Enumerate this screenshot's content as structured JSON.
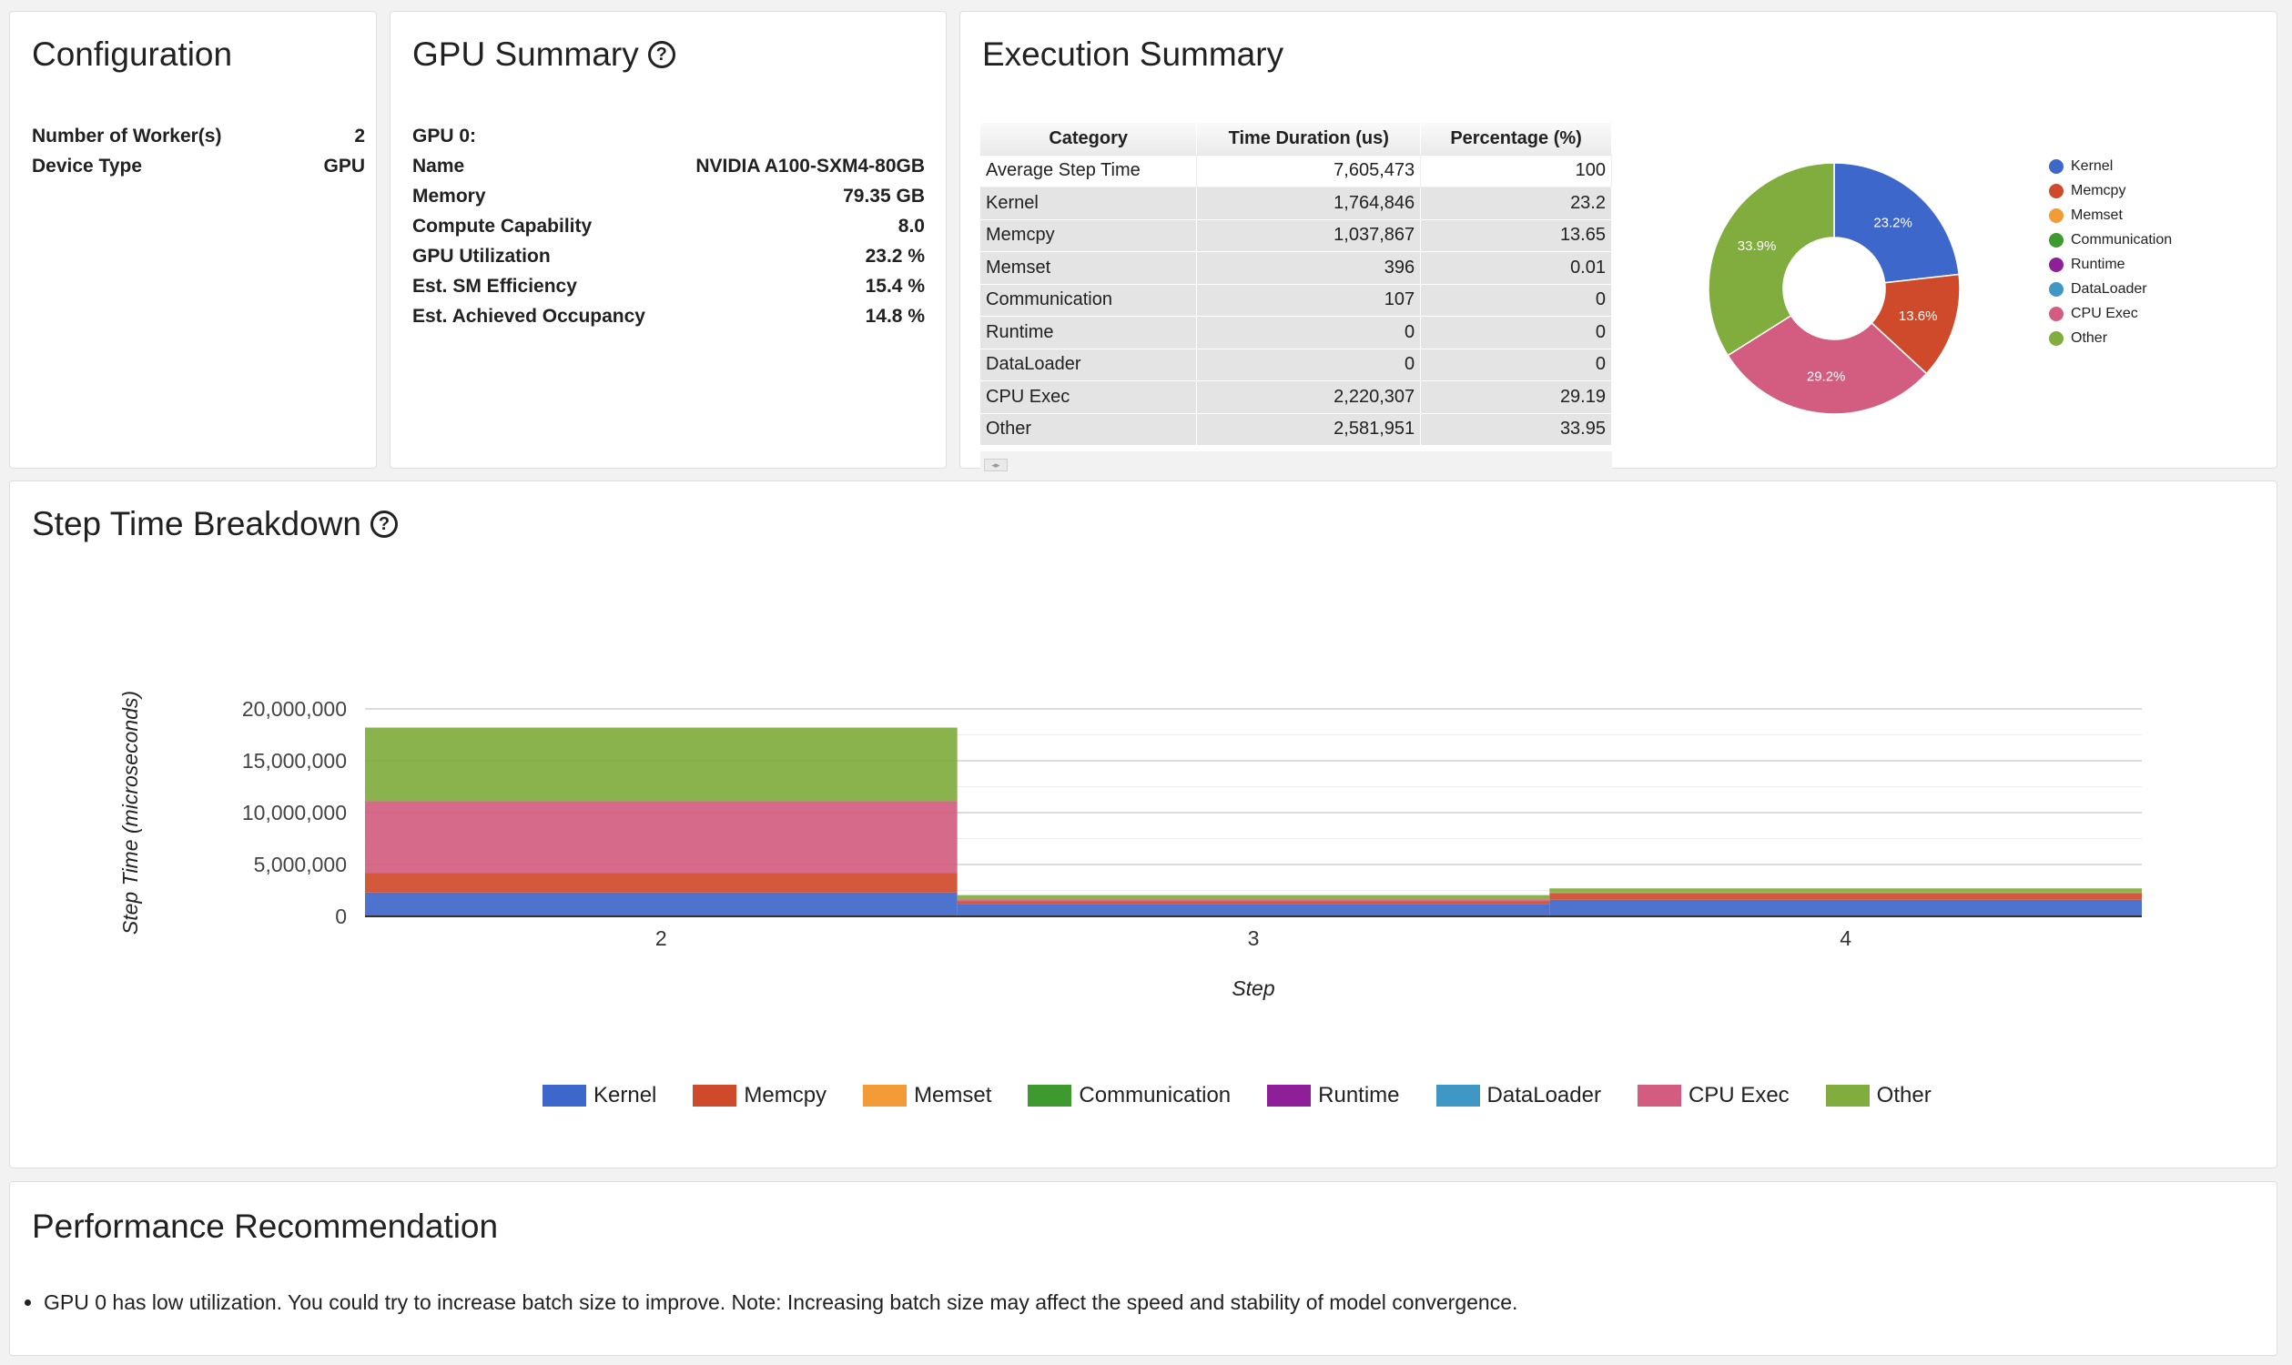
{
  "configuration": {
    "title": "Configuration",
    "rows": [
      {
        "label": "Number of Worker(s)",
        "value": "2"
      },
      {
        "label": "Device Type",
        "value": "GPU"
      }
    ]
  },
  "gpu_summary": {
    "title": "GPU Summary",
    "help_icon": "help-circle-icon",
    "gpu_label": "GPU 0:",
    "rows": [
      {
        "label": "Name",
        "value": "NVIDIA A100-SXM4-80GB"
      },
      {
        "label": "Memory",
        "value": "79.35 GB"
      },
      {
        "label": "Compute Capability",
        "value": "8.0"
      },
      {
        "label": "GPU Utilization",
        "value": "23.2 %"
      },
      {
        "label": "Est. SM Efficiency",
        "value": "15.4 %"
      },
      {
        "label": "Est. Achieved Occupancy",
        "value": "14.8 %"
      }
    ]
  },
  "execution_summary": {
    "title": "Execution Summary",
    "columns": [
      "Category",
      "Time Duration (us)",
      "Percentage (%)"
    ],
    "rows": [
      {
        "category": "Average Step Time",
        "duration": "7,605,473",
        "percentage": "100"
      },
      {
        "category": "Kernel",
        "duration": "1,764,846",
        "percentage": "23.2"
      },
      {
        "category": "Memcpy",
        "duration": "1,037,867",
        "percentage": "13.65"
      },
      {
        "category": "Memset",
        "duration": "396",
        "percentage": "0.01"
      },
      {
        "category": "Communication",
        "duration": "107",
        "percentage": "0"
      },
      {
        "category": "Runtime",
        "duration": "0",
        "percentage": "0"
      },
      {
        "category": "DataLoader",
        "duration": "0",
        "percentage": "0"
      },
      {
        "category": "CPU Exec",
        "duration": "2,220,307",
        "percentage": "29.19"
      },
      {
        "category": "Other",
        "duration": "2,581,951",
        "percentage": "33.95"
      }
    ],
    "pie_legend": [
      "Kernel",
      "Memcpy",
      "Memset",
      "Communication",
      "Runtime",
      "DataLoader",
      "CPU Exec",
      "Other"
    ]
  },
  "colors": {
    "Kernel": "#3e67cb",
    "Memcpy": "#cf4a2b",
    "Memset": "#f39c37",
    "Communication": "#3e9a2f",
    "Runtime": "#8e1f98",
    "DataLoader": "#3f97c5",
    "CPU Exec": "#d35d80",
    "Other": "#81ad3e"
  },
  "step_breakdown": {
    "title": "Step Time Breakdown",
    "help_icon": "help-circle-icon"
  },
  "performance": {
    "title": "Performance Recommendation",
    "items": [
      "GPU 0 has low utilization. You could try to increase batch size to improve. Note: Increasing batch size may affect the speed and stability of model convergence."
    ]
  },
  "chart_data": [
    {
      "type": "pie",
      "style": "donut",
      "labels": [
        "Kernel",
        "Memcpy",
        "Memset",
        "Communication",
        "Runtime",
        "DataLoader",
        "CPU Exec",
        "Other"
      ],
      "values": [
        1764846,
        1037867,
        396,
        107,
        0,
        0,
        2220307,
        2581951
      ],
      "slice_labels": [
        "23.2%",
        "13.6%",
        "",
        "",
        "",
        "",
        "29.2%",
        "33.9%"
      ],
      "legend": "right"
    },
    {
      "type": "bar",
      "stacked": true,
      "categories": [
        "2",
        "3",
        "4"
      ],
      "xlabel": "Step",
      "ylabel": "Step Time (microseconds)",
      "ylim": [
        0,
        20000000
      ],
      "yticks": [
        "0",
        "5,000,000",
        "10,000,000",
        "15,000,000",
        "20,000,000"
      ],
      "grid": true,
      "legend": "bottom",
      "series": [
        {
          "name": "Kernel",
          "values": [
            2300000,
            1200000,
            1600000
          ]
        },
        {
          "name": "Memcpy",
          "values": [
            1900000,
            250000,
            600000
          ]
        },
        {
          "name": "Memset",
          "values": [
            0,
            0,
            0
          ]
        },
        {
          "name": "Communication",
          "values": [
            0,
            0,
            0
          ]
        },
        {
          "name": "Runtime",
          "values": [
            0,
            0,
            0
          ]
        },
        {
          "name": "DataLoader",
          "values": [
            0,
            0,
            0
          ]
        },
        {
          "name": "CPU Exec",
          "values": [
            6900000,
            200000,
            100000
          ]
        },
        {
          "name": "Other",
          "values": [
            7100000,
            400000,
            400000
          ]
        }
      ]
    }
  ]
}
